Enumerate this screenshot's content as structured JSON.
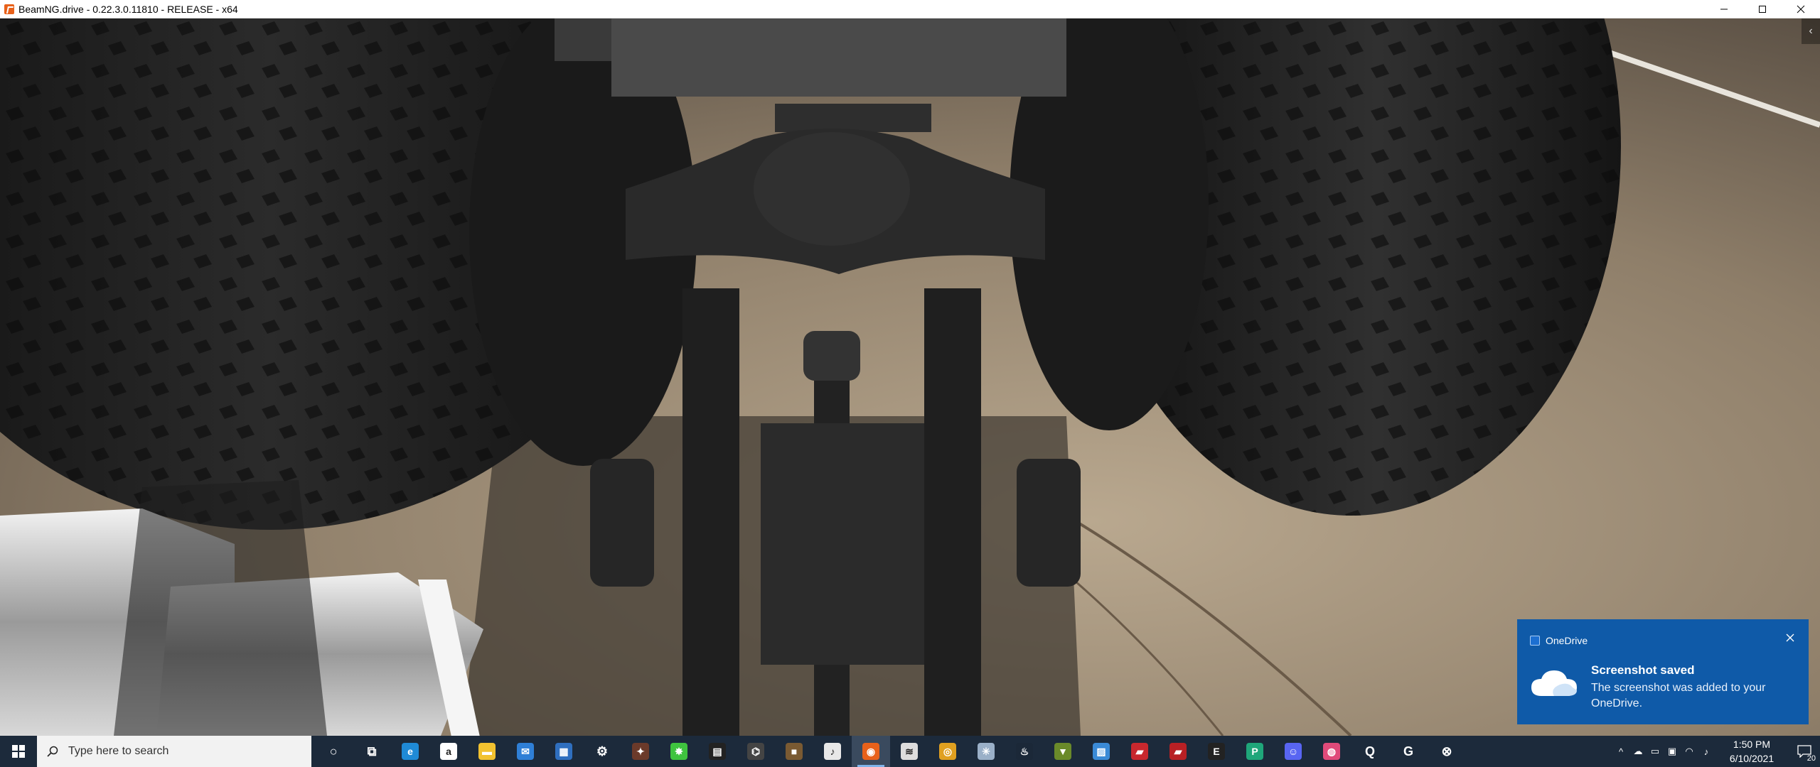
{
  "window": {
    "title": "BeamNG.drive - 0.22.3.0.11810 - RELEASE - x64",
    "controls": [
      "minimize",
      "maximize",
      "close"
    ]
  },
  "viewport": {
    "scene": "rear truck axle underside view",
    "side_tab_glyph": "‹"
  },
  "toast": {
    "app_name": "OneDrive",
    "title": "Screenshot saved",
    "body": "The screenshot was added to your OneDrive.",
    "background": "#0f5aa8"
  },
  "taskbar": {
    "search_placeholder": "Type here to search",
    "pinned": [
      {
        "name": "cortana-icon",
        "glyph": "○",
        "color": "transparent"
      },
      {
        "name": "task-view-icon",
        "glyph": "⧉",
        "color": "transparent"
      },
      {
        "name": "edge-icon",
        "glyph": "e",
        "color": "#1f8ad6"
      },
      {
        "name": "amazon-icon",
        "glyph": "a",
        "color": "#ffffff"
      },
      {
        "name": "file-explorer-icon",
        "glyph": "▬",
        "color": "#f2c230"
      },
      {
        "name": "mail-icon",
        "glyph": "✉",
        "color": "#2f7fd6"
      },
      {
        "name": "store-icon",
        "glyph": "▦",
        "color": "#2f6fbf"
      },
      {
        "name": "settings-icon",
        "glyph": "⚙",
        "color": "transparent"
      },
      {
        "name": "game-icon",
        "glyph": "✦",
        "color": "#6b3a2a"
      },
      {
        "name": "razer-icon",
        "glyph": "✸",
        "color": "#3fc43f"
      },
      {
        "name": "media-icon",
        "glyph": "▤",
        "color": "#222222"
      },
      {
        "name": "app-icon",
        "glyph": "⌬",
        "color": "#444444"
      },
      {
        "name": "minecraft-icon",
        "glyph": "■",
        "color": "#7a5a32"
      },
      {
        "name": "itunes-icon",
        "glyph": "♪",
        "color": "#e8e8e8"
      },
      {
        "name": "beamng-icon",
        "glyph": "◉",
        "color": "#e8611a"
      },
      {
        "name": "layers-icon",
        "glyph": "≋",
        "color": "#dddddd"
      },
      {
        "name": "chrome-icon",
        "glyph": "◎",
        "color": "#e0a020"
      },
      {
        "name": "gear-app-icon",
        "glyph": "✳",
        "color": "#9ab0c8"
      },
      {
        "name": "steam-icon",
        "glyph": "♨",
        "color": "#1b2838"
      },
      {
        "name": "green-app-icon",
        "glyph": "▼",
        "color": "#6a8a2a"
      },
      {
        "name": "photos-icon",
        "glyph": "▨",
        "color": "#3a8ad6"
      },
      {
        "name": "red-app-icon",
        "glyph": "▰",
        "color": "#c8282e"
      },
      {
        "name": "red-app-2-icon",
        "glyph": "▰",
        "color": "#b82024"
      },
      {
        "name": "epic-games-icon",
        "glyph": "E",
        "color": "#222222"
      },
      {
        "name": "green-p-icon",
        "glyph": "P",
        "color": "#1fa67a"
      },
      {
        "name": "discord-icon",
        "glyph": "☺",
        "color": "#5865f2"
      },
      {
        "name": "pink-app-icon",
        "glyph": "◍",
        "color": "#e04a7a"
      },
      {
        "name": "q-app-icon",
        "glyph": "Q",
        "color": "transparent"
      },
      {
        "name": "g-app-icon",
        "glyph": "G",
        "color": "transparent"
      },
      {
        "name": "xbox-icon",
        "glyph": "⊗",
        "color": "transparent"
      }
    ],
    "active_index": 14,
    "tray": [
      "^",
      "☁",
      "▭",
      "▣",
      "◠",
      "♪"
    ],
    "time": "1:50 PM",
    "date": "6/10/2021",
    "notification_count": "20"
  }
}
